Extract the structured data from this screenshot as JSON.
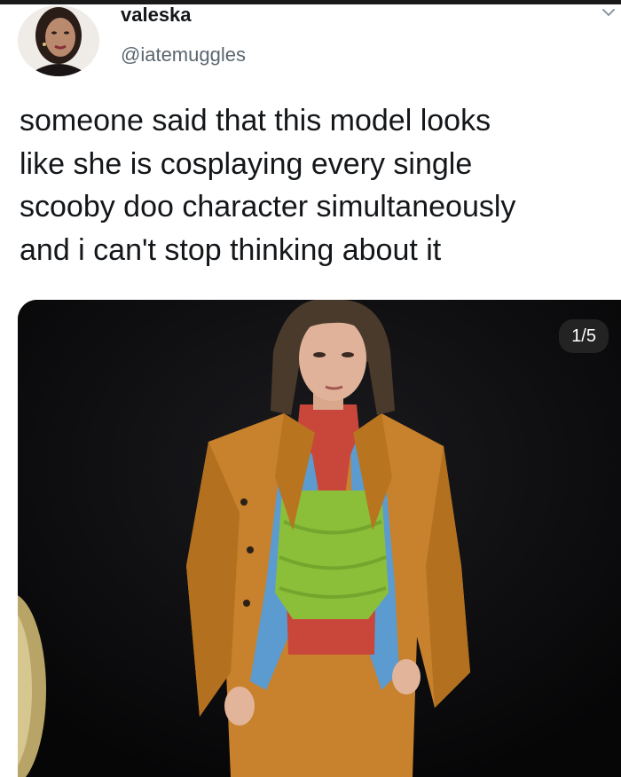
{
  "author": {
    "display_name": "valeska",
    "handle": "@iatemuggles"
  },
  "tweet": {
    "lines": [
      "someone said that this model looks",
      "like she is cosplaying every single",
      "scooby doo character simultaneously",
      "and i can't stop thinking about it"
    ]
  },
  "media": {
    "counter": "1/5"
  },
  "icons": {
    "menu": "chevron-down-icon"
  },
  "colors": {
    "text": "#14171a",
    "secondary_text": "#5b6670",
    "media_background": "#0b0b0d",
    "jacket": "#c8812c",
    "turtleneck": "#c9473a",
    "shirt": "#5b9bd0",
    "drape_top": "#8bbf3a",
    "trousers": "#e8a48a"
  }
}
